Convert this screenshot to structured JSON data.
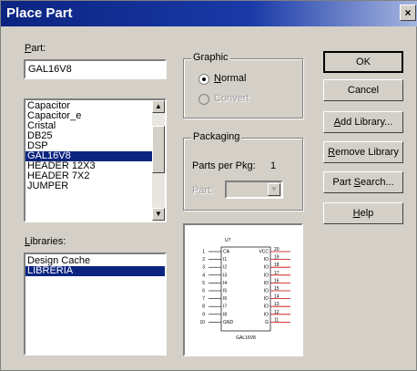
{
  "window": {
    "title": "Place Part",
    "close_glyph": "×"
  },
  "part": {
    "label_u": "P",
    "label_rest": "art:",
    "value": "GAL16V8"
  },
  "parts_list": {
    "items": [
      "Capacitor",
      "Capacitor_e",
      "Cristal",
      "DB25",
      "DSP",
      "GAL16V8",
      "HEADER 12X3",
      "HEADER 7X2",
      "JUMPER"
    ],
    "selected_index": 5
  },
  "libraries": {
    "label_u": "L",
    "label_rest": "ibraries:",
    "items": [
      "Design Cache",
      "LIBRERIA"
    ],
    "selected_index": 1
  },
  "graphic": {
    "title": "Graphic",
    "normal_u": "N",
    "normal_rest": "ormal",
    "convert_label": "Convert"
  },
  "packaging": {
    "title": "Packaging",
    "parts_per_pkg_label": "Parts per Pkg:",
    "parts_per_pkg_value": "1",
    "part_label": "Part:"
  },
  "buttons": {
    "ok": "OK",
    "cancel": "Cancel",
    "add_library_u": "A",
    "add_library_rest": "dd Library...",
    "remove_library_u": "R",
    "remove_library_rest": "emove Library",
    "part_search_pre": "Part ",
    "part_search_u": "S",
    "part_search_rest": "earch...",
    "help_u": "H",
    "help_rest": "elp"
  },
  "preview": {
    "ref": "U?",
    "part_name": "GAL16V8",
    "left_pins": [
      {
        "num": "1",
        "name": "Clk"
      },
      {
        "num": "2",
        "name": "I1"
      },
      {
        "num": "3",
        "name": "I2"
      },
      {
        "num": "4",
        "name": "I3"
      },
      {
        "num": "5",
        "name": "I4"
      },
      {
        "num": "6",
        "name": "I5"
      },
      {
        "num": "7",
        "name": "I6"
      },
      {
        "num": "8",
        "name": "I7"
      },
      {
        "num": "9",
        "name": "I8"
      },
      {
        "num": "10",
        "name": "GND"
      }
    ],
    "right_pins": [
      {
        "num": "20",
        "name": "VCC"
      },
      {
        "num": "19",
        "name": "IO"
      },
      {
        "num": "18",
        "name": "IO"
      },
      {
        "num": "17",
        "name": "IO"
      },
      {
        "num": "16",
        "name": "IO"
      },
      {
        "num": "15",
        "name": "IO"
      },
      {
        "num": "14",
        "name": "IO"
      },
      {
        "num": "13",
        "name": "IO"
      },
      {
        "num": "12",
        "name": "IO"
      },
      {
        "num": "11",
        "name": "G"
      }
    ]
  },
  "colors": {
    "title_bar": "#0b2480",
    "selection": "#0b2480",
    "pin_lines": "#c00000"
  }
}
